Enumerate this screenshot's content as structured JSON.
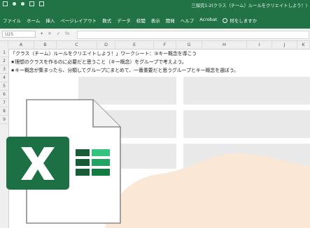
{
  "window": {
    "title": "三探究1-2(クラス（チーム）ルールをクリエイトしよう！)"
  },
  "ribbon": {
    "tabs": [
      "ファイル",
      "ホーム",
      "挿入",
      "ページレイアウト",
      "数式",
      "データ",
      "校閲",
      "表示",
      "開発",
      "ヘルプ",
      "Acrobat"
    ],
    "search_label": "何をしますか"
  },
  "formula_bar": {
    "name_box": "U25",
    "fx_label": "fx"
  },
  "columns": [
    "A",
    "B",
    "C",
    "D",
    "E",
    "F",
    "G",
    "H",
    "I",
    "J",
    "K"
  ],
  "rows": [
    "1",
    "2",
    "3",
    "4",
    "5",
    "6",
    "7",
    "8",
    "9"
  ],
  "cells": {
    "row1": "「クラス（チーム）ルールをクリエイトしよう！」ワークシート：③キー概念を導こう",
    "row2": "★理想のクラスを作るのに必要だと思うこと（キー概念）をグループで考えよう。",
    "row3": "★キー概念が集まったら、分類してグループにまとめて、一番重要だと思うグループとキー概念を選ぼう。"
  },
  "colors": {
    "excel_green": "#217346",
    "peach_background": "#fbe7d6",
    "icon_dark_green": "#185c37",
    "icon_green": "#21a366"
  }
}
